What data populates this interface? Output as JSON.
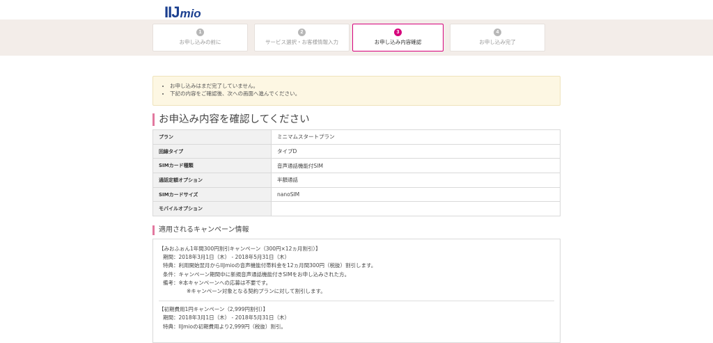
{
  "brand": {
    "logo_main": "IIJ",
    "logo_sub": "mio"
  },
  "steps": [
    {
      "num": "1",
      "label": "お申し込みの前に"
    },
    {
      "num": "2",
      "label": "サービス選択・お客様情報入力"
    },
    {
      "num": "3",
      "label": "お申し込み内容確認"
    },
    {
      "num": "4",
      "label": "お申し込み完了"
    }
  ],
  "notice": [
    "お申し込みはまだ完了していません。",
    "下記の内容をご確認後、次への画面へ進んでください。"
  ],
  "confirm": {
    "title": "お申込み内容を確認してください",
    "rows": [
      {
        "label": "プラン",
        "value": "ミニマムスタートプラン"
      },
      {
        "label": "回線タイプ",
        "value": "タイプD"
      },
      {
        "label": "SIMカード種類",
        "value": "音声通話機能付SIM"
      },
      {
        "label": "通話定額オプション",
        "value": "半額通話"
      },
      {
        "label": "SIMカードサイズ",
        "value": "nanoSIM"
      },
      {
        "label": "モバイルオプション",
        "value": ""
      }
    ]
  },
  "campaign": {
    "title": "適用されるキャンペーン情報",
    "c1": {
      "name": "【みおふぉん1年間300円割引キャンペーン（300円×12ヵ月割引）】",
      "period": "期間：2018年3月1日（木） - 2018年5月31日（木）",
      "benefit": "特典：利用開始翌月からIIJmioの音声機能付帯料金を12ヵ月間300円（税抜）割引します。",
      "condition": "条件：キャンペーン期間中に新規音声通話機能付きSIMをお申し込みされた方。",
      "note1": "備考：※本キャンペーンへの応募は不要です。",
      "note2": "※キャンペーン対象となる契約プランに対して割引します。"
    },
    "c2": {
      "name": "【初期費用1円キャンペーン（2,999円割引）】",
      "period": "期間：2018年3月1日（木） - 2018年5月31日（木）",
      "benefit": "特典：IIJmioの初期費用より2,999円（税抜）割引。"
    }
  }
}
